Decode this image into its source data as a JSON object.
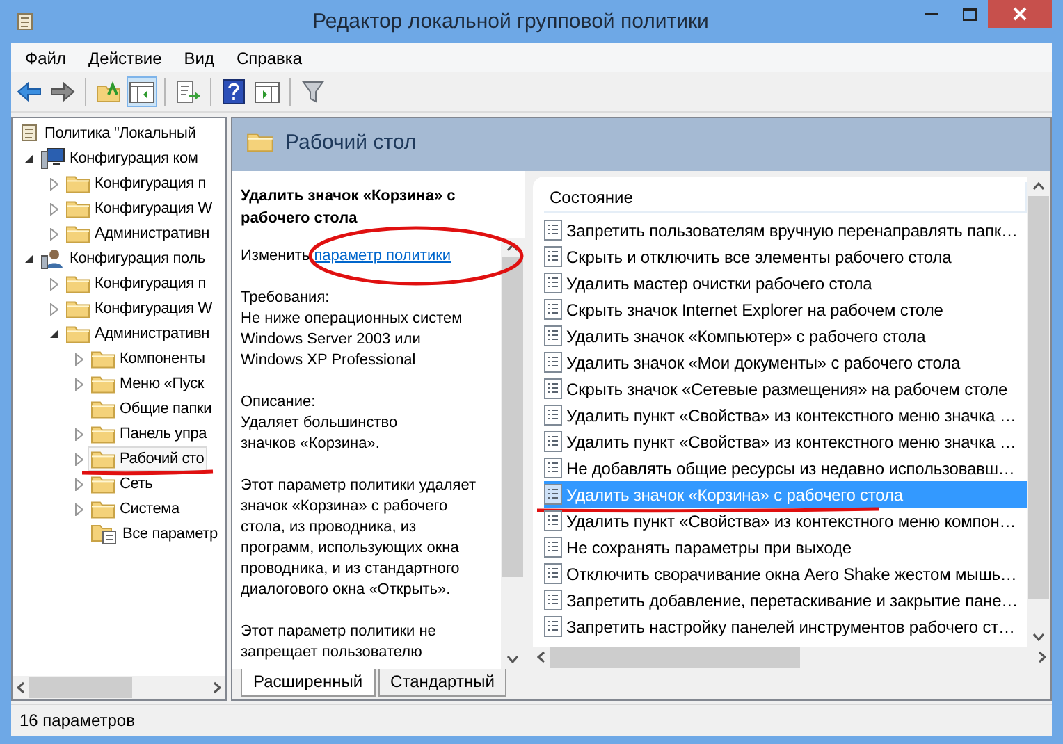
{
  "window": {
    "title": "Редактор локальной групповой политики"
  },
  "menu": [
    "Файл",
    "Действие",
    "Вид",
    "Справка"
  ],
  "toolbar": [
    {
      "kind": "back",
      "pressed": false
    },
    {
      "kind": "forward",
      "pressed": false
    },
    {
      "kind": "separator"
    },
    {
      "kind": "up",
      "pressed": false
    },
    {
      "kind": "tree",
      "pressed": true
    },
    {
      "kind": "separator"
    },
    {
      "kind": "export",
      "pressed": false
    },
    {
      "kind": "separator"
    },
    {
      "kind": "help",
      "pressed": false
    },
    {
      "kind": "pane",
      "pressed": false
    },
    {
      "kind": "separator"
    },
    {
      "kind": "filter",
      "pressed": false
    }
  ],
  "tree": [
    {
      "label": "Политика \"Локальный",
      "kind": "policy",
      "selected": false,
      "underlined": false,
      "children": [
        {
          "label": "Конфигурация ком",
          "kind": "computer",
          "expanded": true,
          "selected": false,
          "underlined": false,
          "children": [
            {
              "label": "Конфигурация п",
              "kind": "folder",
              "expanded": false,
              "selected": false,
              "underlined": false
            },
            {
              "label": "Конфигурация W",
              "kind": "folder",
              "expanded": false,
              "selected": false,
              "underlined": false
            },
            {
              "label": "Административн",
              "kind": "folder",
              "expanded": false,
              "selected": false,
              "underlined": false
            }
          ]
        },
        {
          "label": "Конфигурация поль",
          "kind": "user",
          "expanded": true,
          "selected": false,
          "underlined": false,
          "children": [
            {
              "label": "Конфигурация п",
              "kind": "folder",
              "expanded": false,
              "selected": false,
              "underlined": false
            },
            {
              "label": "Конфигурация W",
              "kind": "folder",
              "expanded": false,
              "selected": false,
              "underlined": false
            },
            {
              "label": "Административн",
              "kind": "folder",
              "expanded": true,
              "selected": false,
              "underlined": false,
              "children": [
                {
                  "label": "Компоненты",
                  "kind": "folder",
                  "expanded": false,
                  "selected": false,
                  "underlined": false
                },
                {
                  "label": "Меню «Пуск",
                  "kind": "folder",
                  "expanded": false,
                  "selected": false,
                  "underlined": false
                },
                {
                  "label": "Общие папки",
                  "kind": "folder",
                  "selected": false,
                  "underlined": false
                },
                {
                  "label": "Панель упра",
                  "kind": "folder",
                  "expanded": false,
                  "selected": false,
                  "underlined": false
                },
                {
                  "label": "Рабочий сто",
                  "kind": "folder",
                  "expanded": false,
                  "selected": true,
                  "underlined": true
                },
                {
                  "label": "Сеть",
                  "kind": "folder",
                  "expanded": false,
                  "selected": false,
                  "underlined": false
                },
                {
                  "label": "Система",
                  "kind": "folder",
                  "expanded": false,
                  "selected": false,
                  "underlined": false
                },
                {
                  "label": "Все параметр",
                  "kind": "folder-list",
                  "selected": false,
                  "underlined": false
                }
              ]
            }
          ]
        }
      ]
    }
  ],
  "header": {
    "title": "Рабочий стол"
  },
  "description": {
    "title": "Удалить значок «Корзина» с\nрабочего стола",
    "edit_prefix": "Изменить",
    "edit_link": "параметр политики",
    "link_circled": true,
    "paragraphs": [
      "Требования:\nНе ниже операционных систем\nWindows Server 2003 или\nWindows XP Professional",
      "Описание:\nУдаляет большинство\nзначков «Корзина».",
      "Этот параметр политики удаляет\nзначок «Корзина» с рабочего\nстола, из проводника, из\nпрограмм, использующих окна\nпроводника, и из стандартного\nдиалогового окна «Открыть».",
      "Этот параметр политики не\nзапрещает пользователю"
    ]
  },
  "tabs": [
    {
      "label": "Расширенный",
      "selected": true
    },
    {
      "label": "Стандартный",
      "selected": false
    }
  ],
  "list": {
    "column": "Состояние",
    "rows": [
      {
        "label": "Запретить пользователям вручную перенаправлять папк…",
        "selected": false,
        "underlined": false
      },
      {
        "label": "Скрыть и отключить все элементы рабочего стола",
        "selected": false,
        "underlined": false
      },
      {
        "label": "Удалить мастер очистки рабочего стола",
        "selected": false,
        "underlined": false
      },
      {
        "label": "Скрыть значок Internet Explorer на рабочем столе",
        "selected": false,
        "underlined": false
      },
      {
        "label": "Удалить значок «Компьютер» с рабочего стола",
        "selected": false,
        "underlined": false
      },
      {
        "label": "Удалить значок «Мои документы» с рабочего стола",
        "selected": false,
        "underlined": false
      },
      {
        "label": "Скрыть значок «Сетевые размещения» на рабочем столе",
        "selected": false,
        "underlined": false
      },
      {
        "label": "Удалить пункт «Свойства» из контекстного меню значка …",
        "selected": false,
        "underlined": false
      },
      {
        "label": "Удалить пункт «Свойства» из контекстного меню значка …",
        "selected": false,
        "underlined": false
      },
      {
        "label": "Не добавлять общие ресурсы из недавно использовавш…",
        "selected": false,
        "underlined": false
      },
      {
        "label": "Удалить значок «Корзина» с рабочего стола",
        "selected": true,
        "underlined": true
      },
      {
        "label": "Удалить пункт «Свойства» из контекстного меню компон…",
        "selected": false,
        "underlined": false
      },
      {
        "label": "Не сохранять параметры при выходе",
        "selected": false,
        "underlined": false
      },
      {
        "label": "Отключить сворачивание окна Aero Shake жестом мышь…",
        "selected": false,
        "underlined": false
      },
      {
        "label": "Запретить добавление, перетаскивание и закрытие пане…",
        "selected": false,
        "underlined": false
      },
      {
        "label": "Запретить настройку панелей инструментов рабочего ст…",
        "selected": false,
        "underlined": false
      }
    ]
  },
  "status_bar": "16 параметров"
}
